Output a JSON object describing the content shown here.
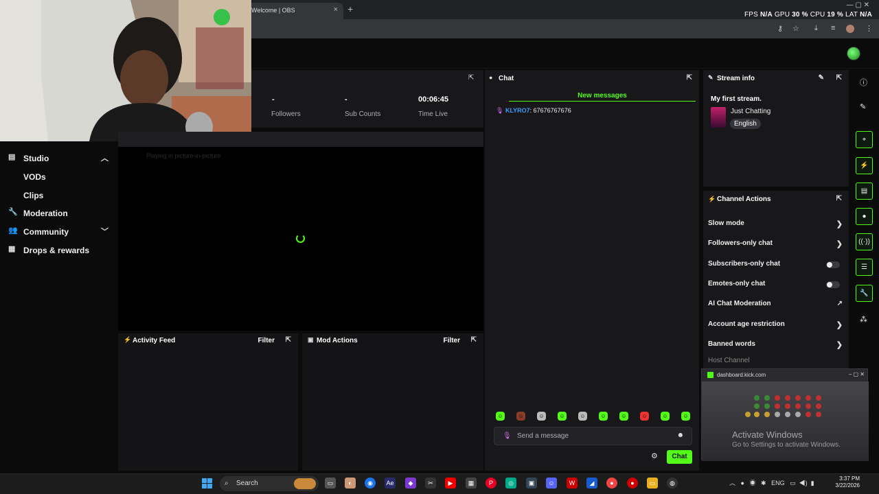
{
  "browser": {
    "tab_title": "Welcome | OBS",
    "close_glyph": "×",
    "newtab_glyph": "+",
    "stats": {
      "fps_label": "FPS",
      "fps": "N/A",
      "gpu_label": "GPU",
      "gpu": "30 %",
      "cpu_label": "CPU",
      "cpu": "19 %",
      "lat_label": "LAT",
      "lat": "N/A"
    }
  },
  "sidebar": {
    "items": [
      {
        "label": "Studio",
        "icon": "studio-icon",
        "expanded": true
      },
      {
        "label": "VODs",
        "icon": "",
        "sub": true
      },
      {
        "label": "Clips",
        "icon": "",
        "sub": true
      },
      {
        "label": "Moderation",
        "icon": "wrench-icon"
      },
      {
        "label": "Community",
        "icon": "people-icon",
        "expandable": true
      },
      {
        "label": "Drops & rewards",
        "icon": "gift-icon"
      }
    ]
  },
  "stats_panel": {
    "followers_value": "-",
    "followers_label": "Followers",
    "subs_value": "-",
    "subs_label": "Sub Counts",
    "time_value": "00:06:45",
    "time_label": "Time Live"
  },
  "video": {
    "pip_text": "Playing in picture-in-picture"
  },
  "activity_feed": {
    "title": "Activity Feed",
    "filter": "Filter"
  },
  "mod_actions": {
    "title": "Mod Actions",
    "filter": "Filter"
  },
  "chat": {
    "title": "Chat",
    "new_messages": "New messages",
    "messages": [
      {
        "user": "KLYRO7",
        "text": ": 67676767676"
      }
    ],
    "input_placeholder": "Send a message",
    "send_label": "Chat"
  },
  "stream_info": {
    "title": "Stream info",
    "stream_title": "My first stream.",
    "category": "Just Chatting",
    "language": "English"
  },
  "channel_actions": {
    "title": "Channel Actions",
    "rows": [
      {
        "label": "Slow mode",
        "control": "chevron"
      },
      {
        "label": "Followers-only chat",
        "control": "chevron"
      },
      {
        "label": "Subscribers-only chat",
        "control": "toggle",
        "on": false
      },
      {
        "label": "Emotes-only chat",
        "control": "toggle",
        "on": false
      },
      {
        "label": "AI Chat Moderation",
        "control": "external"
      },
      {
        "label": "Account age restriction",
        "control": "chevron"
      },
      {
        "label": "Banned words",
        "control": "chevron"
      }
    ],
    "host_channel": "Host Channel"
  },
  "mini_window": {
    "url": "dashboard.kick.com"
  },
  "activate_windows": {
    "line1": "Activate Windows",
    "line2": "Go to Settings to activate Windows."
  },
  "taskbar": {
    "search_label": "Search",
    "tray_lang": "ENG",
    "time": "3:37 PM",
    "date": "3/22/2026"
  },
  "colors": {
    "accent": "#53fc18",
    "panel": "#18181b",
    "background": "#0b0b0c"
  }
}
